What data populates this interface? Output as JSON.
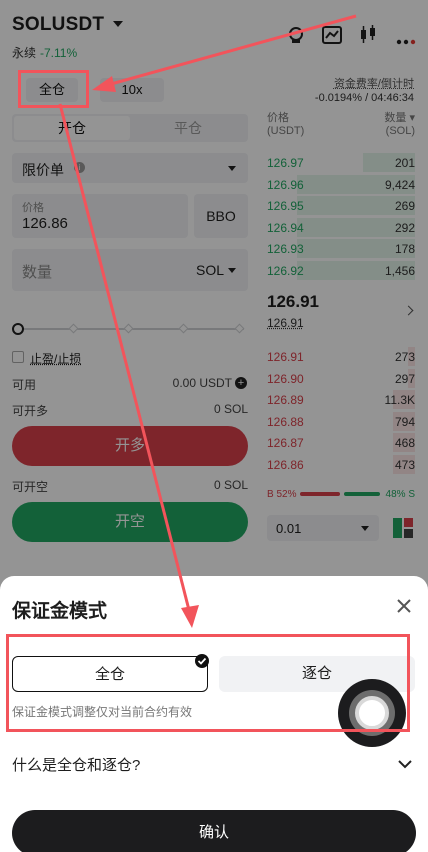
{
  "header": {
    "symbol": "SOLUSDT",
    "contract_type": "永续",
    "change": "-7.11%"
  },
  "mode_buttons": {
    "margin_mode": "全仓",
    "leverage": "10x"
  },
  "funding": {
    "label": "资金费率/倒计时",
    "value": "-0.0194% / 04:46:34"
  },
  "trade_tabs": {
    "open": "开仓",
    "close": "平仓"
  },
  "order_type": "限价单",
  "price_field": {
    "label": "价格",
    "value": "126.86",
    "bbo": "BBO"
  },
  "qty_field": {
    "placeholder": "数量",
    "unit": "SOL"
  },
  "tpsl": "止盈/止损",
  "available": {
    "label": "可用",
    "value": "0.00 USDT"
  },
  "can_open_long": {
    "label": "可开多",
    "value": "0 SOL"
  },
  "long_button": "开多",
  "can_open_short": {
    "label": "可开空",
    "value": "0 SOL"
  },
  "short_button": "开空",
  "orderbook": {
    "price_header": "价格",
    "price_unit": "(USDT)",
    "qty_header": "数量",
    "qty_unit": "(SOL)",
    "asks": [
      {
        "price": "126.97",
        "qty": "201",
        "depth": 0.35
      },
      {
        "price": "126.96",
        "qty": "9,424",
        "depth": 0.8
      },
      {
        "price": "126.95",
        "qty": "269",
        "depth": 0.8
      },
      {
        "price": "126.94",
        "qty": "292",
        "depth": 0.8
      },
      {
        "price": "126.93",
        "qty": "178",
        "depth": 0.8
      },
      {
        "price": "126.92",
        "qty": "1,456",
        "depth": 0.8
      }
    ],
    "mid_price": "126.91",
    "mark_price": "126.91",
    "bids": [
      {
        "price": "126.91",
        "qty": "273",
        "depth": 0.05
      },
      {
        "price": "126.90",
        "qty": "297",
        "depth": 0.05
      },
      {
        "price": "126.89",
        "qty": "11.3K",
        "depth": 0.15
      },
      {
        "price": "126.88",
        "qty": "794",
        "depth": 0.15
      },
      {
        "price": "126.87",
        "qty": "468",
        "depth": 0.15
      },
      {
        "price": "126.86",
        "qty": "473",
        "depth": 0.15
      }
    ],
    "buy_ratio": "B 52%",
    "sell_ratio": "48% S",
    "buy_fraction": 0.52,
    "precision": "0.01"
  },
  "sheet": {
    "title": "保证金模式",
    "option_cross": "全仓",
    "option_isolated": "逐仓",
    "hint": "保证金模式调整仅对当前合约有效",
    "faq": "什么是全仓和逐仓?",
    "confirm": "确认"
  },
  "colors": {
    "red": "#d9404a",
    "green": "#21a862",
    "annotation": "#f2545b"
  }
}
